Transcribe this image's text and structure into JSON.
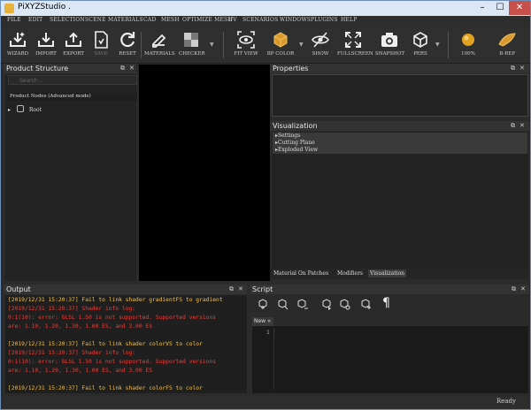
{
  "window": {
    "title": "PiXYZStudio ."
  },
  "menu": [
    "FILE",
    "EDIT",
    "SELECTION",
    "SCENE",
    "MATERIALS",
    "CAD",
    "MESH",
    "OPTIMIZE MESH",
    "UV",
    "SCENARIOS",
    "WINDOWS",
    "PLUGINS",
    "HELP"
  ],
  "toolbar": {
    "wizard": "WIZARD",
    "import": "IMPORT",
    "export": "EXPORT",
    "save": "SAVE",
    "reset": "RESET",
    "materials": "MATERIALS",
    "checker": "CHECKER",
    "fit_view": "FIT VIEW",
    "bp_color": "BP COLOR",
    "show": "SHOW",
    "fullscreen": "FULLSCREEN",
    "snapshot": "SNAPSHOT",
    "pers": "PERS",
    "zoom": "100%",
    "brep": "B-REP"
  },
  "product_structure": {
    "title": "Product Structure",
    "search_placeholder": "Search...",
    "header": "Product Nodes  (Advanced mode)",
    "root": "Root"
  },
  "properties": {
    "title": "Properties"
  },
  "visualization": {
    "title": "Visualization",
    "items": [
      "Settings",
      "Cutting Plane",
      "Exploded View"
    ]
  },
  "bottom_tabs": [
    "Material On Patches",
    "Modifiers",
    "Visualization"
  ],
  "output": {
    "title": "Output",
    "lines": [
      {
        "text": "[2019/12/31 15:20:37] Fail to link shader gradientFS to gradient",
        "color": "yellow"
      },
      {
        "text": "[2019/12/31 15:20:37] Shader info log:",
        "color": "red"
      },
      {
        "text": "0:1(10): error: GLSL 1.50 is not supported. Supported versions",
        "color": "red"
      },
      {
        "text": "are: 1.10, 1.20, 1.30, 1.00 ES, and 3.00 ES",
        "color": "red"
      },
      {
        "text": "",
        "color": "red"
      },
      {
        "text": "[2019/12/31 15:20:37] Fail to link shader colorVS to color",
        "color": "yellow"
      },
      {
        "text": "[2019/12/31 15:20:37] Shader info log:",
        "color": "red"
      },
      {
        "text": "0:1(10): error: GLSL 1.50 is not supported. Supported versions",
        "color": "red"
      },
      {
        "text": "are: 1.10, 1.20, 1.30, 1.00 ES, and 3.00 ES",
        "color": "red"
      },
      {
        "text": "",
        "color": "red"
      },
      {
        "text": "[2019/12/31 15:20:37] Fail to link shader colorFS to color",
        "color": "yellow"
      }
    ]
  },
  "script": {
    "title": "Script",
    "tab_label": "New",
    "line_no": "1",
    "paragraph": "¶"
  },
  "status": {
    "text": "Ready"
  },
  "glyphs": {
    "close": "✕",
    "float": "⧉",
    "min": "–",
    "max": "☐"
  }
}
